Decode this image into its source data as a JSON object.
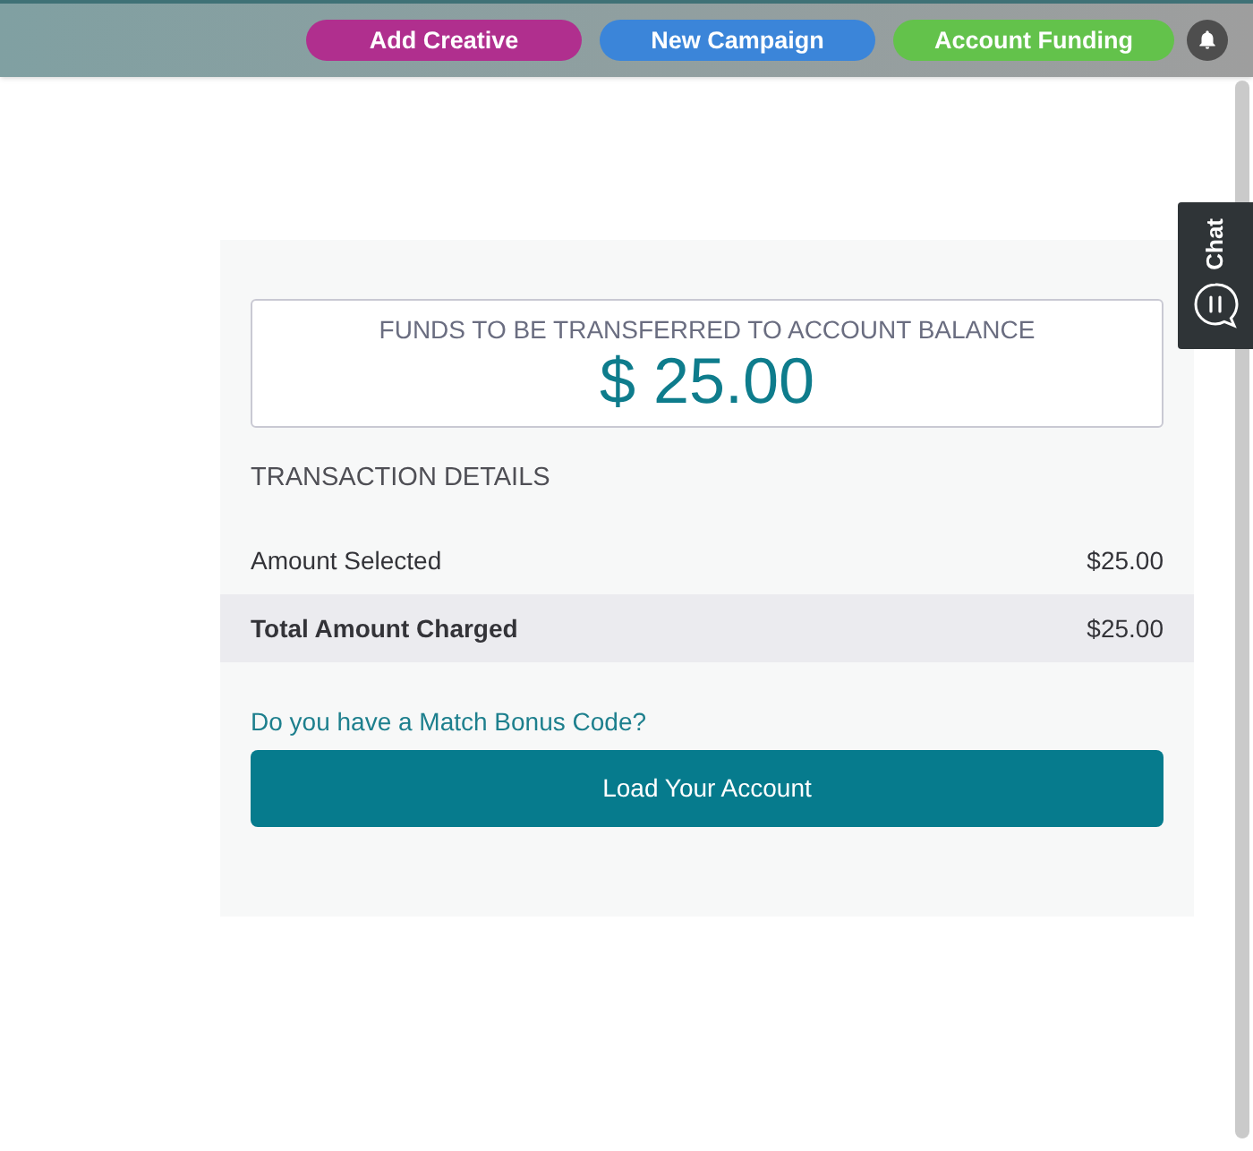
{
  "header": {
    "buttons": [
      {
        "label": "Add Creative",
        "color": "#b02f8e"
      },
      {
        "label": "New Campaign",
        "color": "#3b85d9"
      },
      {
        "label": "Account Funding",
        "color": "#63c24b"
      }
    ]
  },
  "chat_tab": {
    "label": "Chat"
  },
  "funds": {
    "title": "FUNDS TO BE TRANSFERRED TO ACCOUNT BALANCE",
    "amount": "$ 25.00"
  },
  "transaction": {
    "heading": "TRANSACTION DETAILS",
    "rows": [
      {
        "kind": "item",
        "label": "Amount Selected",
        "value": "$25.00"
      },
      {
        "kind": "total",
        "label": "Total Amount Charged",
        "value": "$25.00"
      }
    ]
  },
  "bonus_link": "Do you have a Match Bonus Code?",
  "submit_button": "Load Your Account"
}
